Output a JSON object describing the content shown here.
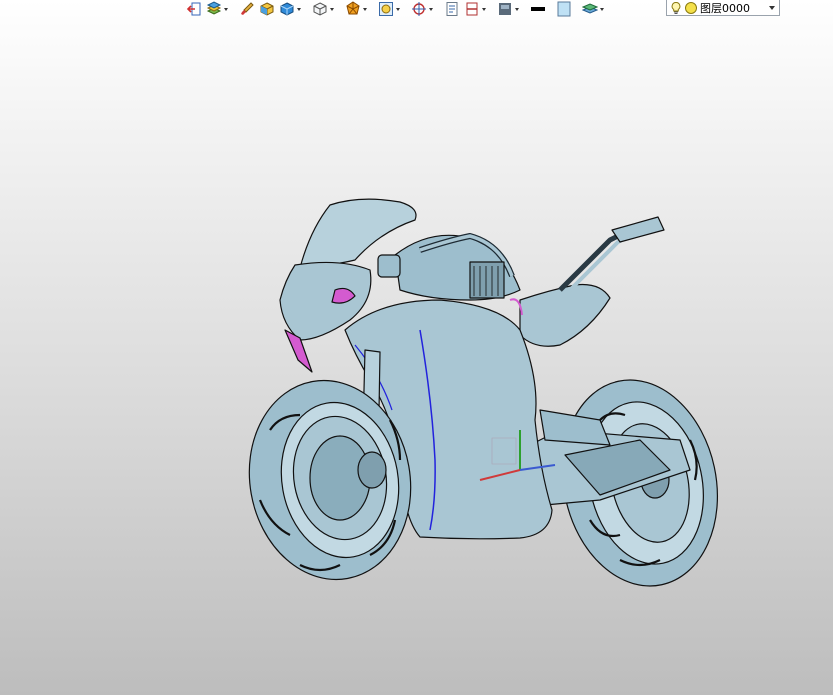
{
  "toolbar": {
    "items": [
      {
        "name": "exit-icon",
        "dropdown": false
      },
      {
        "name": "layer-manager-icon",
        "dropdown": true
      },
      {
        "name": "brush-icon",
        "dropdown": false
      },
      {
        "name": "render-cube-icon",
        "dropdown": false
      },
      {
        "name": "solid-cube-icon",
        "dropdown": true
      },
      {
        "name": "wireframe-cube-icon",
        "dropdown": true
      },
      {
        "name": "shading-style-icon",
        "dropdown": true
      },
      {
        "name": "zoom-view-icon",
        "dropdown": true
      },
      {
        "name": "snap-target-icon",
        "dropdown": true
      },
      {
        "name": "document-icon",
        "dropdown": false
      },
      {
        "name": "section-icon",
        "dropdown": true
      },
      {
        "name": "display-mode-icon",
        "dropdown": true
      },
      {
        "name": "line-color-icon",
        "dropdown": false
      },
      {
        "name": "fill-color-icon",
        "dropdown": false
      },
      {
        "name": "layers-stack-icon",
        "dropdown": true
      }
    ]
  },
  "layer": {
    "current": "图层0000",
    "bulb_icon": "lightbulb-icon",
    "status_color": "#f4e04a"
  },
  "colors": {
    "model_fill": "#a9c6d3",
    "model_fill_dark": "#87a9b8",
    "edge": "#111111",
    "highlight_magenta": "#d45bd0",
    "highlight_blue": "#2222dd"
  }
}
